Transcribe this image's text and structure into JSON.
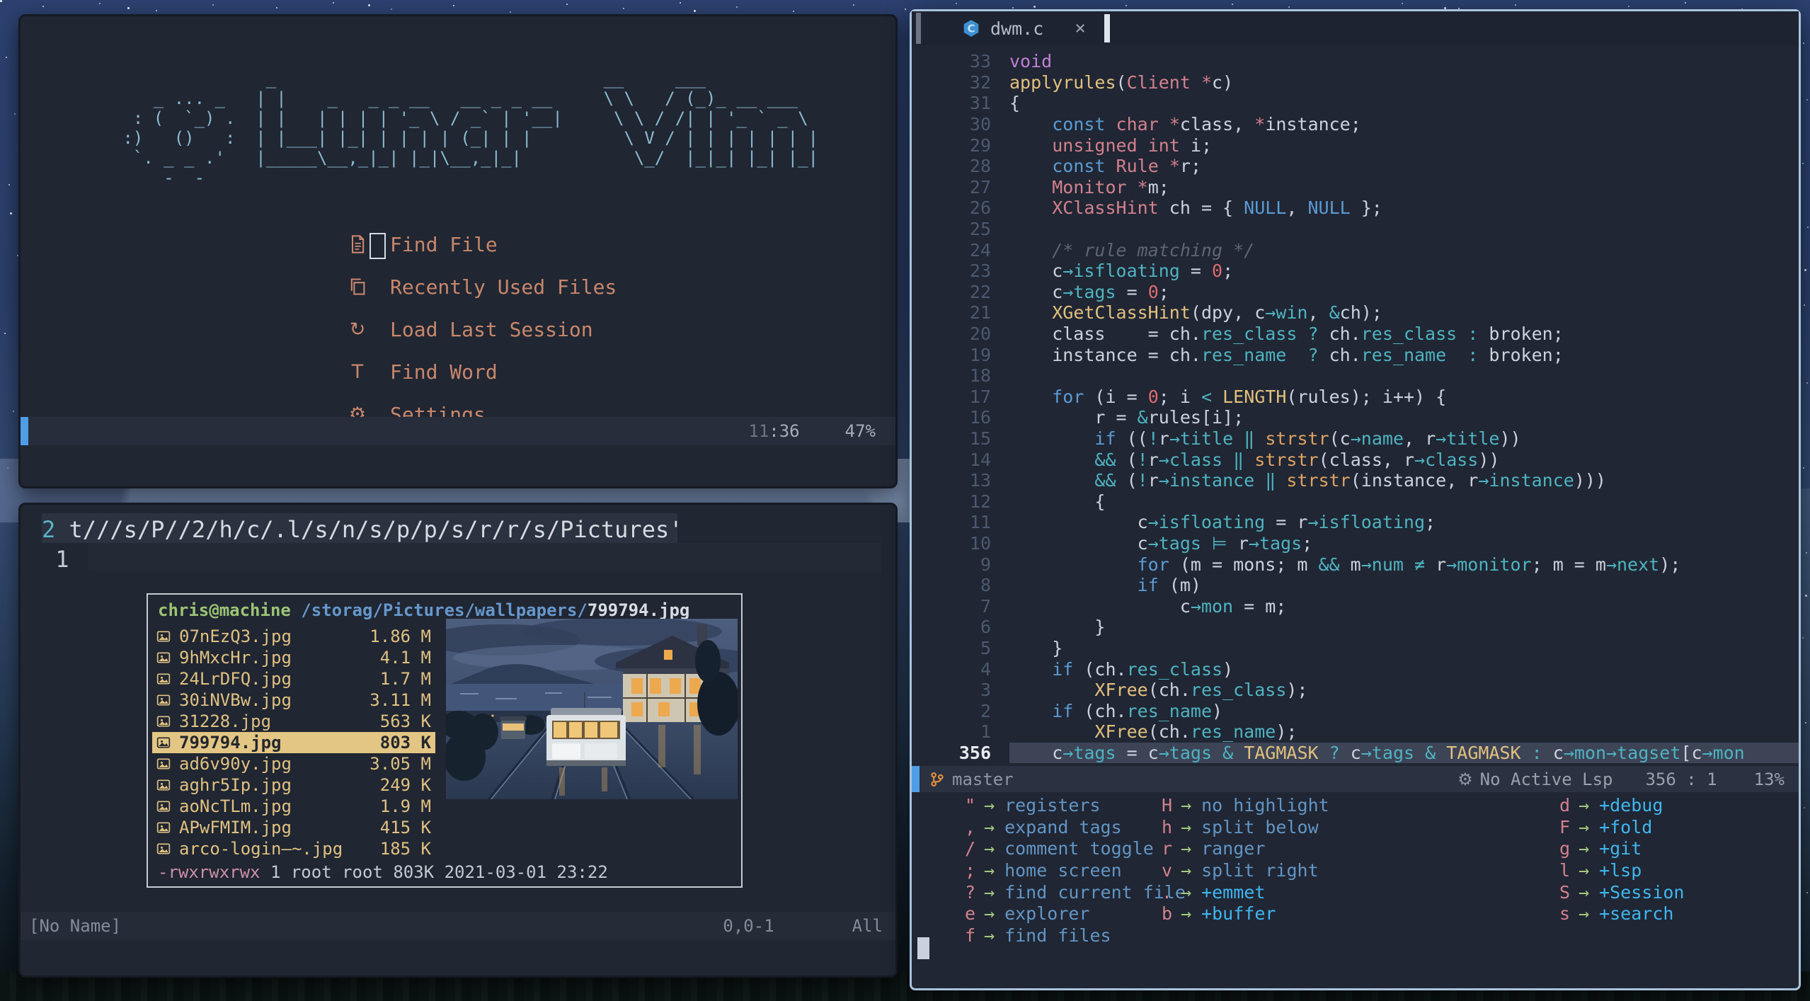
{
  "dashboard": {
    "banner": "               _                                __     ___\n    _ ... _   | |    _   _ _ __   __ _ _ __     \\ \\   / (_)_ __ ___\n  : (  `_) .  | |   | | | | '_ \\ / _` | '__|     \\ \\ / /| | '_ ` _ \\\n :)   ()   :  | |___| |_| | | | | (_| | |         \\ V / | | | | | | |\n  `. _ _ .'   |_____\\__,_|_| |_|\\__,_|_|           \\_/  |_|_| |_| |_|\n     -  -",
    "menu": [
      {
        "icon": "file-icon",
        "label": "Find File"
      },
      {
        "icon": "copy-icon",
        "label": "Recently Used Files"
      },
      {
        "icon": "reload-icon",
        "label": "Load Last Session"
      },
      {
        "icon": "letter-t-icon",
        "label": "Find Word"
      },
      {
        "icon": "gear-icon",
        "label": "Settings"
      }
    ],
    "statusline": {
      "pos_dim": "11",
      "pos": ":36",
      "percent": "47%"
    }
  },
  "terminal": {
    "lnum1": "2",
    "line1": "t///s/P//2/h/c/.l/s/n/s/p/p/s/r/r/s/Pictures'",
    "lnum2": "1",
    "statusline": {
      "left": "[No Name]",
      "pos": "0,0-1",
      "scroll": "All"
    }
  },
  "ranger": {
    "user": "chris@machine",
    "path": " /storag/Pictures/wallpapers/",
    "file": "799794.jpg",
    "files": [
      {
        "icon": "image-icon",
        "name": "07nEzQ3.jpg",
        "size": "1.86 M",
        "selected": false
      },
      {
        "icon": "image-icon",
        "name": "9hMxcHr.jpg",
        "size": "4.1 M",
        "selected": false
      },
      {
        "icon": "image-icon",
        "name": "24LrDFQ.jpg",
        "size": "1.7 M",
        "selected": false
      },
      {
        "icon": "image-icon",
        "name": "30iNVBw.jpg",
        "size": "3.11 M",
        "selected": false
      },
      {
        "icon": "image-icon",
        "name": "31228.jpg",
        "size": "563 K",
        "selected": false
      },
      {
        "icon": "image-icon",
        "name": "799794.jpg",
        "size": "803 K",
        "selected": true
      },
      {
        "icon": "image-icon",
        "name": "ad6v90y.jpg",
        "size": "3.05 M",
        "selected": false
      },
      {
        "icon": "image-icon",
        "name": "aghr5Ip.jpg",
        "size": "249 K",
        "selected": false
      },
      {
        "icon": "image-icon",
        "name": "aoNcTLm.jpg",
        "size": "1.9 M",
        "selected": false
      },
      {
        "icon": "image-icon",
        "name": "APwFMIM.jpg",
        "size": "415 K",
        "selected": false
      },
      {
        "icon": "image-icon",
        "name": "arco-login—~.jpg",
        "size": "185 K",
        "selected": false
      }
    ],
    "perms": "-rwxrwxrwx",
    "perms_rest": " 1 root root 803K 2021-03-01 23:22"
  },
  "editor": {
    "tab": {
      "icon": "c-language-icon",
      "title": "dwm.c",
      "close": "×"
    },
    "lines": [
      {
        "n": "33",
        "tokens": [
          [
            "v",
            "void"
          ]
        ]
      },
      {
        "n": "32",
        "tokens": [
          [
            "y",
            "applyrules"
          ],
          [
            "w",
            "("
          ],
          [
            "p",
            "Client"
          ],
          [
            "w",
            " "
          ],
          [
            "p",
            "*"
          ],
          [
            "w",
            "c)"
          ]
        ]
      },
      {
        "n": "31",
        "tokens": [
          [
            "w",
            "{"
          ]
        ]
      },
      {
        "n": "30",
        "tokens": [
          [
            "w",
            "    "
          ],
          [
            "b",
            "const"
          ],
          [
            "w",
            " "
          ],
          [
            "p",
            "char"
          ],
          [
            "w",
            " "
          ],
          [
            "p",
            "*"
          ],
          [
            "w",
            "class, "
          ],
          [
            "p",
            "*"
          ],
          [
            "w",
            "instance;"
          ]
        ]
      },
      {
        "n": "29",
        "tokens": [
          [
            "w",
            "    "
          ],
          [
            "p",
            "unsigned int"
          ],
          [
            "w",
            " i;"
          ]
        ]
      },
      {
        "n": "28",
        "tokens": [
          [
            "w",
            "    "
          ],
          [
            "b",
            "const"
          ],
          [
            "w",
            " "
          ],
          [
            "p",
            "Rule"
          ],
          [
            "w",
            " "
          ],
          [
            "p",
            "*"
          ],
          [
            "w",
            "r;"
          ]
        ]
      },
      {
        "n": "27",
        "tokens": [
          [
            "w",
            "    "
          ],
          [
            "p",
            "Monitor"
          ],
          [
            "w",
            " "
          ],
          [
            "p",
            "*"
          ],
          [
            "w",
            "m;"
          ]
        ]
      },
      {
        "n": "26",
        "tokens": [
          [
            "w",
            "    "
          ],
          [
            "p",
            "XClassHint"
          ],
          [
            "w",
            " ch = { "
          ],
          [
            "b",
            "NULL"
          ],
          [
            "w",
            ", "
          ],
          [
            "b",
            "NULL"
          ],
          [
            "w",
            " };"
          ]
        ]
      },
      {
        "n": "25",
        "tokens": []
      },
      {
        "n": "24",
        "tokens": [
          [
            "w",
            "    "
          ],
          [
            "c",
            "/* rule matching */"
          ]
        ]
      },
      {
        "n": "23",
        "tokens": [
          [
            "w",
            "    c"
          ],
          [
            "t",
            "→isfloating"
          ],
          [
            "w",
            " = "
          ],
          [
            "r",
            "0"
          ],
          [
            "w",
            ";"
          ]
        ]
      },
      {
        "n": "22",
        "tokens": [
          [
            "w",
            "    c"
          ],
          [
            "t",
            "→tags"
          ],
          [
            "w",
            " = "
          ],
          [
            "r",
            "0"
          ],
          [
            "w",
            ";"
          ]
        ]
      },
      {
        "n": "21",
        "tokens": [
          [
            "w",
            "    "
          ],
          [
            "y",
            "XGetClassHint"
          ],
          [
            "w",
            "(dpy, c"
          ],
          [
            "t",
            "→win"
          ],
          [
            "w",
            ", "
          ],
          [
            "t",
            "&"
          ],
          [
            "w",
            "ch);"
          ]
        ]
      },
      {
        "n": "20",
        "tokens": [
          [
            "w",
            "    class    = ch."
          ],
          [
            "t",
            "res_class"
          ],
          [
            "w",
            " "
          ],
          [
            "t",
            "?"
          ],
          [
            "w",
            " ch."
          ],
          [
            "t",
            "res_class"
          ],
          [
            "w",
            " "
          ],
          [
            "t",
            ":"
          ],
          [
            "w",
            " broken;"
          ]
        ]
      },
      {
        "n": "19",
        "tokens": [
          [
            "w",
            "    instance = ch."
          ],
          [
            "t",
            "res_name"
          ],
          [
            "w",
            "  "
          ],
          [
            "t",
            "?"
          ],
          [
            "w",
            " ch."
          ],
          [
            "t",
            "res_name"
          ],
          [
            "w",
            "  "
          ],
          [
            "t",
            ":"
          ],
          [
            "w",
            " broken;"
          ]
        ]
      },
      {
        "n": "18",
        "tokens": []
      },
      {
        "n": "17",
        "tokens": [
          [
            "w",
            "    "
          ],
          [
            "b",
            "for"
          ],
          [
            "w",
            " (i = "
          ],
          [
            "r",
            "0"
          ],
          [
            "w",
            "; i "
          ],
          [
            "t",
            "<"
          ],
          [
            "w",
            " "
          ],
          [
            "y",
            "LENGTH"
          ],
          [
            "w",
            "(rules); i++) {"
          ]
        ]
      },
      {
        "n": "16",
        "tokens": [
          [
            "w",
            "        r = "
          ],
          [
            "t",
            "&"
          ],
          [
            "w",
            "rules[i];"
          ]
        ]
      },
      {
        "n": "15",
        "tokens": [
          [
            "w",
            "        "
          ],
          [
            "b",
            "if"
          ],
          [
            "w",
            " (("
          ],
          [
            "t",
            "!"
          ],
          [
            "w",
            "r"
          ],
          [
            "t",
            "→title"
          ],
          [
            "w",
            " "
          ],
          [
            "t",
            "‖"
          ],
          [
            "w",
            " "
          ],
          [
            "o",
            "strstr"
          ],
          [
            "w",
            "(c"
          ],
          [
            "t",
            "→name"
          ],
          [
            "w",
            ", r"
          ],
          [
            "t",
            "→title"
          ],
          [
            "w",
            "))"
          ]
        ]
      },
      {
        "n": "14",
        "tokens": [
          [
            "w",
            "        "
          ],
          [
            "t",
            "&&"
          ],
          [
            "w",
            " ("
          ],
          [
            "t",
            "!"
          ],
          [
            "w",
            "r"
          ],
          [
            "t",
            "→class"
          ],
          [
            "w",
            " "
          ],
          [
            "t",
            "‖"
          ],
          [
            "w",
            " "
          ],
          [
            "o",
            "strstr"
          ],
          [
            "w",
            "(class, r"
          ],
          [
            "t",
            "→class"
          ],
          [
            "w",
            "))"
          ]
        ]
      },
      {
        "n": "13",
        "tokens": [
          [
            "w",
            "        "
          ],
          [
            "t",
            "&&"
          ],
          [
            "w",
            " ("
          ],
          [
            "t",
            "!"
          ],
          [
            "w",
            "r"
          ],
          [
            "t",
            "→instance"
          ],
          [
            "w",
            " "
          ],
          [
            "t",
            "‖"
          ],
          [
            "w",
            " "
          ],
          [
            "o",
            "strstr"
          ],
          [
            "w",
            "(instance, r"
          ],
          [
            "t",
            "→instance"
          ],
          [
            "w",
            ")))"
          ]
        ]
      },
      {
        "n": "12",
        "tokens": [
          [
            "w",
            "        {"
          ]
        ]
      },
      {
        "n": "11",
        "tokens": [
          [
            "w",
            "            c"
          ],
          [
            "t",
            "→isfloating"
          ],
          [
            "w",
            " = r"
          ],
          [
            "t",
            "→isfloating"
          ],
          [
            "w",
            ";"
          ]
        ]
      },
      {
        "n": "10",
        "tokens": [
          [
            "w",
            "            c"
          ],
          [
            "t",
            "→tags"
          ],
          [
            "w",
            " "
          ],
          [
            "t",
            "⊨"
          ],
          [
            "w",
            " r"
          ],
          [
            "t",
            "→tags"
          ],
          [
            "w",
            ";"
          ]
        ]
      },
      {
        "n": "9",
        "tokens": [
          [
            "w",
            "            "
          ],
          [
            "b",
            "for"
          ],
          [
            "w",
            " (m = mons; m "
          ],
          [
            "t",
            "&&"
          ],
          [
            "w",
            " m"
          ],
          [
            "t",
            "→num"
          ],
          [
            "w",
            " "
          ],
          [
            "t",
            "≠"
          ],
          [
            "w",
            " r"
          ],
          [
            "t",
            "→monitor"
          ],
          [
            "w",
            "; m = m"
          ],
          [
            "t",
            "→next"
          ],
          [
            "w",
            ");"
          ]
        ]
      },
      {
        "n": "8",
        "tokens": [
          [
            "w",
            "            "
          ],
          [
            "b",
            "if"
          ],
          [
            "w",
            " (m)"
          ]
        ]
      },
      {
        "n": "7",
        "tokens": [
          [
            "w",
            "                c"
          ],
          [
            "t",
            "→mon"
          ],
          [
            "w",
            " = m;"
          ]
        ]
      },
      {
        "n": "6",
        "tokens": [
          [
            "w",
            "        }"
          ]
        ]
      },
      {
        "n": "5",
        "tokens": [
          [
            "w",
            "    }"
          ]
        ]
      },
      {
        "n": "4",
        "tokens": [
          [
            "w",
            "    "
          ],
          [
            "b",
            "if"
          ],
          [
            "w",
            " (ch."
          ],
          [
            "t",
            "res_class"
          ],
          [
            "w",
            ")"
          ]
        ]
      },
      {
        "n": "3",
        "tokens": [
          [
            "w",
            "        "
          ],
          [
            "y",
            "XFree"
          ],
          [
            "w",
            "(ch."
          ],
          [
            "t",
            "res_class"
          ],
          [
            "w",
            ");"
          ]
        ]
      },
      {
        "n": "2",
        "tokens": [
          [
            "w",
            "    "
          ],
          [
            "b",
            "if"
          ],
          [
            "w",
            " (ch."
          ],
          [
            "t",
            "res_name"
          ],
          [
            "w",
            ")"
          ]
        ]
      },
      {
        "n": "1",
        "tokens": [
          [
            "w",
            "        "
          ],
          [
            "y",
            "XFree"
          ],
          [
            "w",
            "(ch."
          ],
          [
            "t",
            "res_name"
          ],
          [
            "w",
            ");"
          ]
        ]
      },
      {
        "n": "356",
        "cursor": true,
        "tokens": [
          [
            "w",
            "    c"
          ],
          [
            "t",
            "→tags"
          ],
          [
            "w",
            " = c"
          ],
          [
            "t",
            "→tags"
          ],
          [
            "w",
            " "
          ],
          [
            "t",
            "&"
          ],
          [
            "w",
            " "
          ],
          [
            "y",
            "TAGMASK"
          ],
          [
            "w",
            " "
          ],
          [
            "t",
            "?"
          ],
          [
            "w",
            " c"
          ],
          [
            "t",
            "→tags"
          ],
          [
            "w",
            " "
          ],
          [
            "t",
            "&"
          ],
          [
            "w",
            " "
          ],
          [
            "y",
            "TAGMASK"
          ],
          [
            "w",
            " "
          ],
          [
            "t",
            ":"
          ],
          [
            "w",
            " c"
          ],
          [
            "t",
            "→mon→tagset"
          ],
          [
            "w",
            "[c"
          ],
          [
            "t",
            "→mon"
          ]
        ]
      }
    ],
    "statusline": {
      "branch": "master",
      "lsp": "No Active Lsp",
      "lsp_icon": "⚙",
      "pos": "356 : 1",
      "percent": "13%"
    }
  },
  "whichkey": {
    "col1": [
      {
        "key": "\"",
        "desc": "registers",
        "group": false
      },
      {
        "key": ",",
        "desc": "expand tags",
        "group": false
      },
      {
        "key": "/",
        "desc": "comment toggle",
        "group": false
      },
      {
        "key": ";",
        "desc": "home screen",
        "group": false
      },
      {
        "key": "?",
        "desc": "find current file",
        "group": false
      },
      {
        "key": "e",
        "desc": "explorer",
        "group": false
      },
      {
        "key": "f",
        "desc": "find files",
        "group": false
      }
    ],
    "col2": [
      {
        "key": "H",
        "desc": "no highlight",
        "group": false
      },
      {
        "key": "h",
        "desc": "split below",
        "group": false
      },
      {
        "key": "r",
        "desc": "ranger",
        "group": false
      },
      {
        "key": "v",
        "desc": "split right",
        "group": false
      },
      {
        "key": ".",
        "desc": "+emmet",
        "group": true
      },
      {
        "key": "b",
        "desc": "+buffer",
        "group": true
      }
    ],
    "col3": [
      {
        "key": "d",
        "desc": "+debug",
        "group": true
      },
      {
        "key": "F",
        "desc": "+fold",
        "group": true
      },
      {
        "key": "g",
        "desc": "+git",
        "group": true
      },
      {
        "key": "l",
        "desc": "+lsp",
        "group": true
      },
      {
        "key": "S",
        "desc": "+Session",
        "group": true
      },
      {
        "key": "s",
        "desc": "+search",
        "group": true
      }
    ]
  },
  "colors": {
    "accent": "#4e9de6",
    "selection_tan": "#e4c684",
    "border_focused": "#a9c3dd",
    "menu_salmon": "#c8876c",
    "logo_blue": "#8abbd2"
  }
}
